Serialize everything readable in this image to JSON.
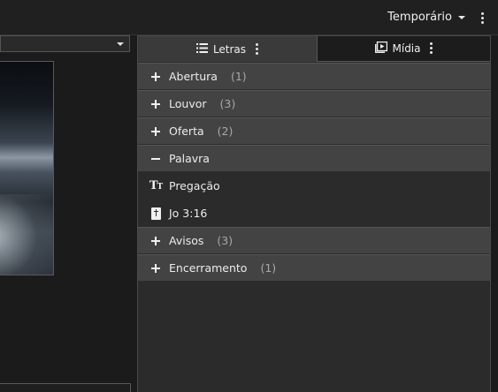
{
  "topbar": {
    "title": "Temporário"
  },
  "tabs": [
    {
      "label": "Letras",
      "icon": "list-icon"
    },
    {
      "label": "Mídia",
      "icon": "media-icon"
    }
  ],
  "sections": [
    {
      "label": "Abertura",
      "count": "(1)",
      "expanded": false
    },
    {
      "label": "Louvor",
      "count": "(3)",
      "expanded": false
    },
    {
      "label": "Oferta",
      "count": "(2)",
      "expanded": false
    },
    {
      "label": "Palavra",
      "count": "",
      "expanded": true
    },
    {
      "label": "Avisos",
      "count": "(3)",
      "expanded": false
    },
    {
      "label": "Encerramento",
      "count": "(1)",
      "expanded": false
    }
  ],
  "palavra_items": [
    {
      "label": "Pregação",
      "icon": "text-icon"
    },
    {
      "label": "Jo 3:16",
      "icon": "bible-icon"
    }
  ],
  "colors": {
    "background": "#1b1b1b",
    "panel": "#2b2b2b",
    "group_row": "#434343",
    "active_tab": "#3a3a3a",
    "text": "#ececec",
    "count": "#a8a8a8"
  }
}
